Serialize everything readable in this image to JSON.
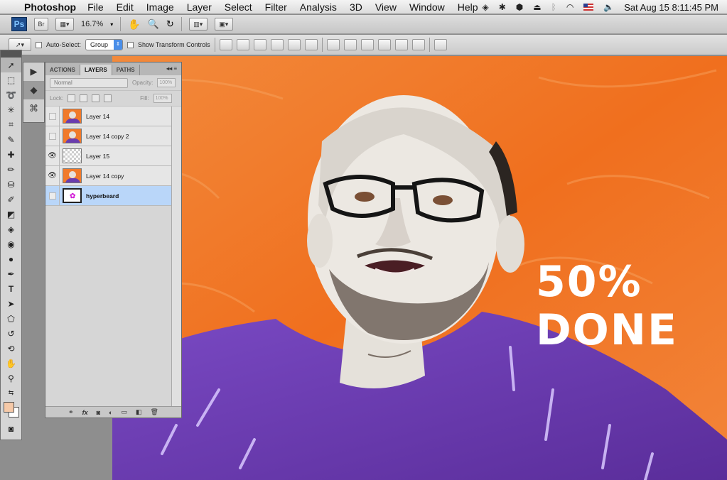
{
  "menubar": {
    "app_name": "Photoshop",
    "menus": [
      "File",
      "Edit",
      "Image",
      "Layer",
      "Select",
      "Filter",
      "Analysis",
      "3D",
      "View",
      "Window",
      "Help"
    ],
    "clock": "Sat Aug 15  8:11:45 PM"
  },
  "appbar": {
    "ps_logo": "Ps",
    "bridge_label": "Br",
    "zoom": "16.7%"
  },
  "options": {
    "auto_select_label": "Auto-Select:",
    "auto_select_value": "Group",
    "transform_label": "Show Transform Controls"
  },
  "layers_panel": {
    "tabs": [
      "ACTIONS",
      "LAYERS",
      "PATHS"
    ],
    "blend_mode": "Normal",
    "opacity_label": "Opacity:",
    "opacity_value": "100%",
    "lock_label": "Lock:",
    "fill_label": "Fill:",
    "fill_value": "100%",
    "layers": [
      {
        "name": "Layer 14",
        "visible": false,
        "thumb": "portrait"
      },
      {
        "name": "Layer 14 copy 2",
        "visible": false,
        "thumb": "portrait"
      },
      {
        "name": "Layer 15",
        "visible": true,
        "thumb": "transparent"
      },
      {
        "name": "Layer 14 copy",
        "visible": true,
        "thumb": "portrait"
      },
      {
        "name": "hyperbeard",
        "visible": false,
        "thumb": "beard",
        "selected": true
      }
    ],
    "footer_icons": [
      "link-icon",
      "fx-icon",
      "mask-icon",
      "adjustment-icon",
      "folder-icon",
      "new-layer-icon",
      "trash-icon"
    ]
  },
  "canvas": {
    "overlay_line1": "50%",
    "overlay_line2": "DONE"
  },
  "colors": {
    "background_orange": "#f17a2a",
    "shirt_purple": "#6a3cae",
    "foreground_swatch": "#f5c9a8",
    "selection_blue": "#b9d6f9"
  }
}
